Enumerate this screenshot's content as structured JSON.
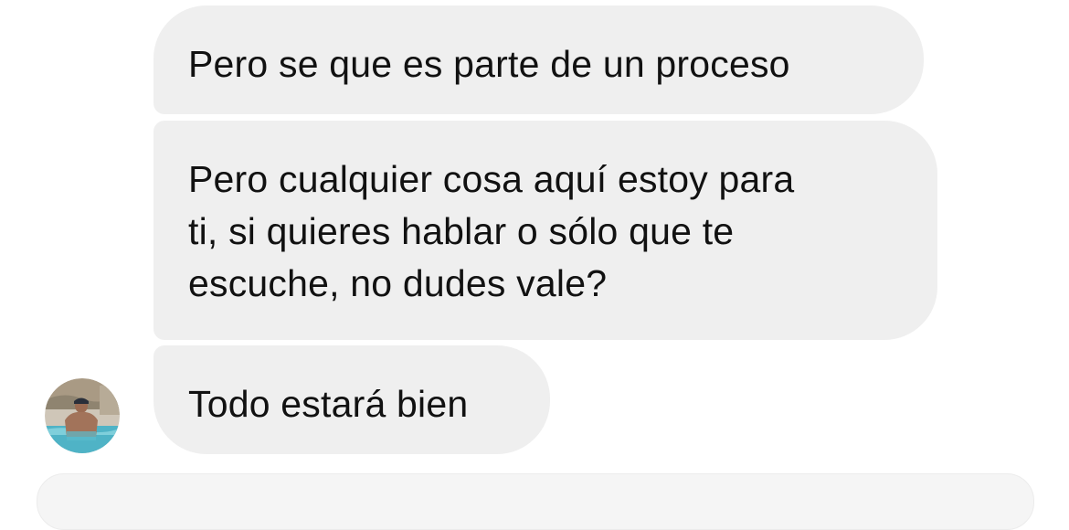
{
  "messages": [
    {
      "lines": [
        "Pero se que es parte de un proceso"
      ]
    },
    {
      "lines": [
        "Pero cualquier cosa aquí estoy para",
        "ti, si quieres hablar o sólo que te",
        "escuche, no dudes vale?"
      ]
    },
    {
      "lines": [
        "Todo estará bien"
      ]
    }
  ],
  "avatar": {
    "icon": "profile-photo-icon"
  },
  "colors": {
    "bubble": "#efefef",
    "text": "#111111",
    "background": "#ffffff"
  }
}
